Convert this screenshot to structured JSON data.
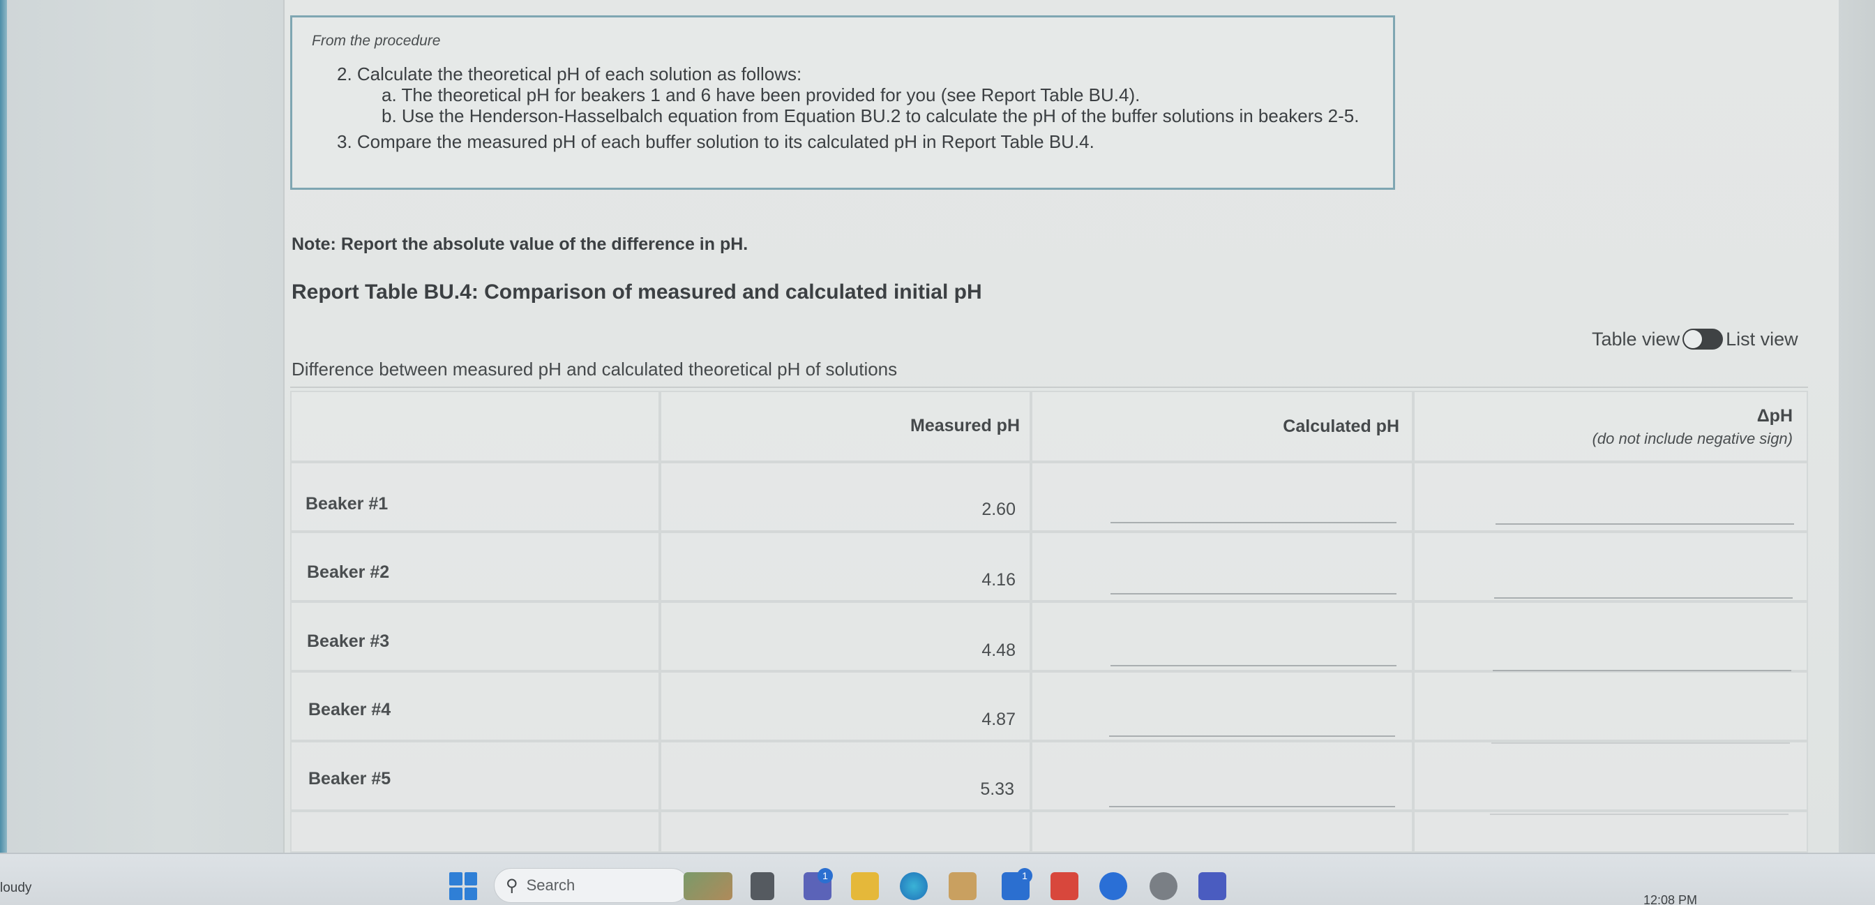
{
  "procedure": {
    "title": "From the procedure",
    "step2": "2. Calculate the theoretical pH of each solution as follows:",
    "step2a": "a. The theoretical pH for beakers 1 and 6 have been provided for you (see Report Table BU.4).",
    "step2b": "b. Use the Henderson-Hasselbalch equation from Equation BU.2 to calculate the pH of the buffer solutions in beakers 2-5.",
    "step3": "3. Compare the measured pH of each buffer solution to its calculated pH in Report Table BU.4."
  },
  "note": "Note: Report the absolute value of the difference in pH.",
  "table_title": "Report Table BU.4: Comparison of measured and calculated initial pH",
  "view_toggle": {
    "table_view": "Table view",
    "list_view": "List view"
  },
  "caption": "Difference between measured pH and calculated theoretical pH of solutions",
  "table": {
    "headers": {
      "measured": "Measured pH",
      "calculated": "Calculated pH",
      "delta": "ΔpH",
      "delta_sub": "(do not include negative sign)"
    },
    "rows": [
      {
        "label": "Beaker #1",
        "measured": "2.60"
      },
      {
        "label": "Beaker #2",
        "measured": "4.16"
      },
      {
        "label": "Beaker #3",
        "measured": "4.48"
      },
      {
        "label": "Beaker #4",
        "measured": "4.87"
      },
      {
        "label": "Beaker #5",
        "measured": "5.33"
      }
    ]
  },
  "taskbar": {
    "weather": "loudy",
    "search_placeholder": "Search",
    "clock": "12:08 PM",
    "badge_teams": "1",
    "badge_linkedin": "1"
  }
}
